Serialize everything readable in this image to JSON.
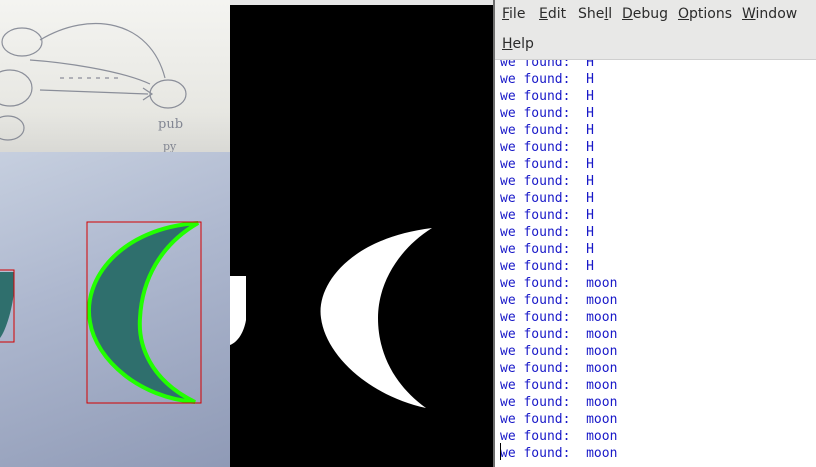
{
  "menu": {
    "file": {
      "pre": "",
      "mn": "F",
      "post": "ile"
    },
    "edit": {
      "pre": "",
      "mn": "E",
      "post": "dit"
    },
    "shell": {
      "pre": "She",
      "mn": "l",
      "post": "l"
    },
    "debug": {
      "pre": "",
      "mn": "D",
      "post": "ebug"
    },
    "options": {
      "pre": "",
      "mn": "O",
      "post": "ptions"
    },
    "window": {
      "pre": "",
      "mn": "W",
      "post": "indow"
    },
    "help": {
      "pre": "",
      "mn": "H",
      "post": "elp"
    }
  },
  "output_lines": [
    "we found:  H",
    "we found:  H",
    "we found:  H",
    "we found:  H",
    "we found:  H",
    "we found:  H",
    "we found:  H",
    "we found:  H",
    "we found:  H",
    "we found:  H",
    "we found:  H",
    "we found:  H",
    "we found:  H",
    "we found:  moon",
    "we found:  moon",
    "we found:  moon",
    "we found:  moon",
    "we found:  moon",
    "we found:  moon",
    "we found:  moon",
    "we found:  moon",
    "we found:  moon",
    "we found:  moon",
    "we found:  moon"
  ],
  "colors": {
    "output_text": "#1818c8",
    "contour": "#22ff00",
    "bounding_box": "#d40000",
    "shape_fill": "#2f6f6d",
    "mask": "#ffffff"
  },
  "icons": {
    "sketch": "hand-drawn-diagram"
  },
  "sketch_text": [
    "pub",
    "py"
  ]
}
